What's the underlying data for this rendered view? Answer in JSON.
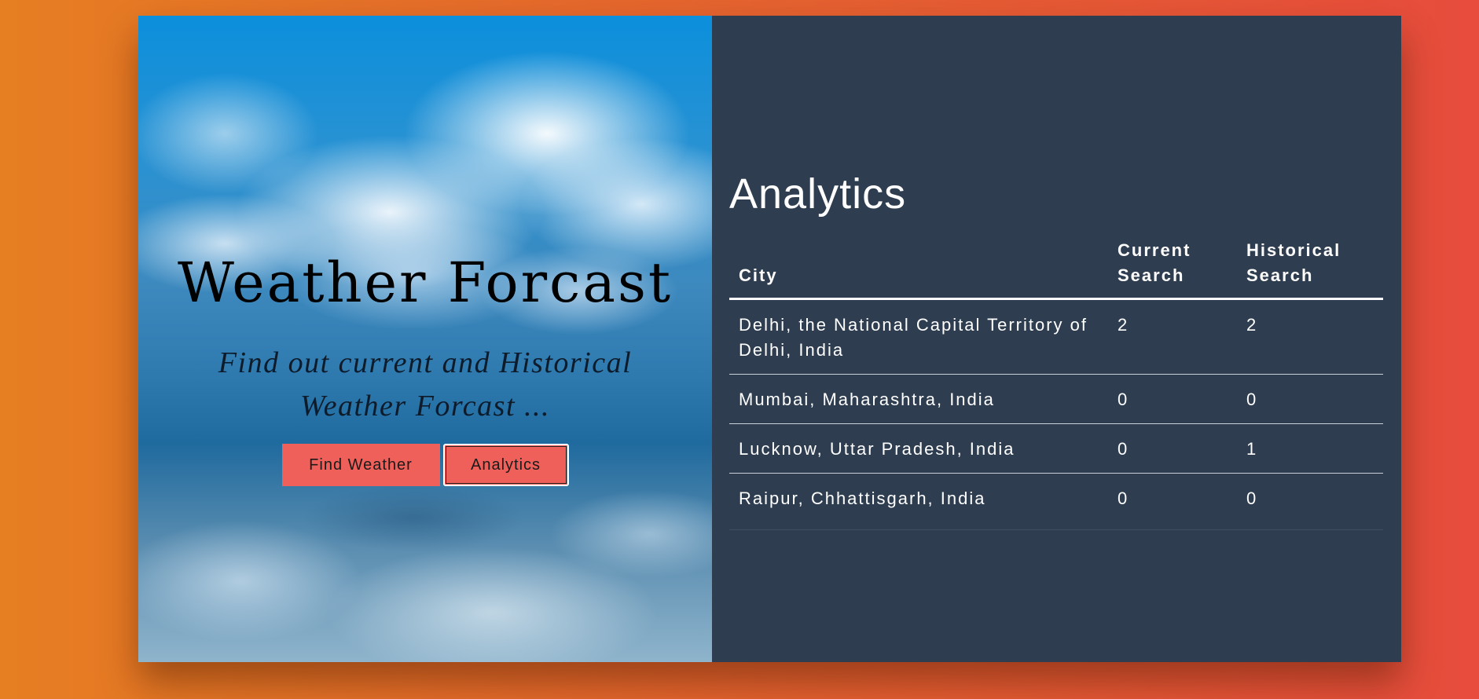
{
  "hero": {
    "title": "Weather Forcast",
    "subtitle": "Find out current and Historical Weather Forcast ...",
    "buttons": {
      "find_weather": "Find Weather",
      "analytics": "Analytics"
    }
  },
  "analytics": {
    "title": "Analytics",
    "columns": [
      "City",
      "Current Search",
      "Historical Search"
    ],
    "rows": [
      {
        "city": "Delhi, the National Capital Territory of Delhi, India",
        "current": "2",
        "historical": "2"
      },
      {
        "city": "Mumbai, Maharashtra, India",
        "current": "0",
        "historical": "0"
      },
      {
        "city": "Lucknow, Uttar Pradesh, India",
        "current": "0",
        "historical": "1"
      },
      {
        "city": "Raipur, Chhattisgarh, India",
        "current": "0",
        "historical": "0"
      }
    ]
  },
  "colors": {
    "background_start": "#e67e22",
    "background_end": "#e74c3c",
    "panel": "#2e3d50",
    "button": "#f0605a"
  }
}
